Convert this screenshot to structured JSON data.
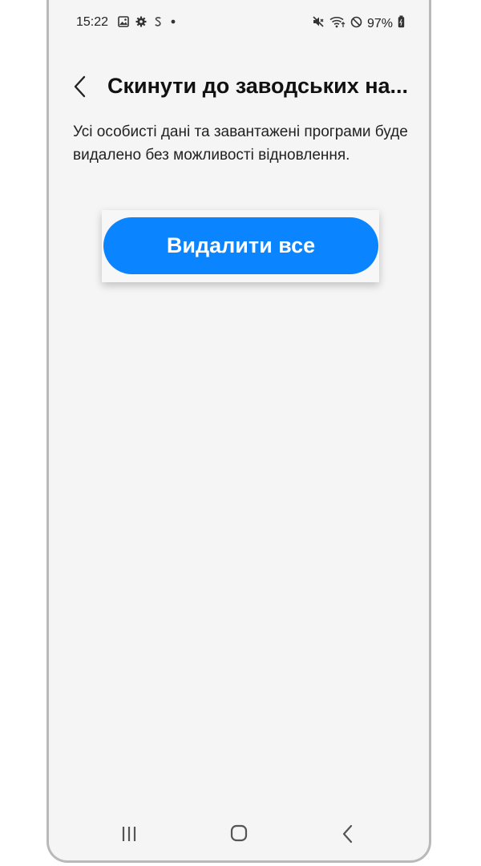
{
  "status_bar": {
    "time": "15:22",
    "battery": "97%",
    "icons_left": [
      "gallery-icon",
      "settings-gear-icon",
      "samsung-s-icon",
      "dot-icon"
    ],
    "icons_right": [
      "mute-icon",
      "wifi-icon",
      "dnd-icon",
      "battery-icon"
    ]
  },
  "header": {
    "title": "Скинути до заводських на..."
  },
  "description": "Усі особисті дані та завантажені програми буде видалено без можливості відновлення.",
  "action": {
    "button_label": "Видалити все",
    "accent_color": "#0a84ff"
  },
  "nav_bar": {
    "buttons": [
      "recent-apps",
      "home",
      "back"
    ]
  }
}
